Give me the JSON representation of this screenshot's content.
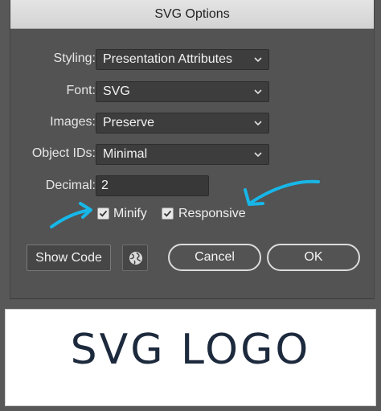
{
  "window": {
    "title": "SVG Options"
  },
  "fields": {
    "styling": {
      "label": "Styling:",
      "value": "Presentation Attributes"
    },
    "font": {
      "label": "Font:",
      "value": "SVG"
    },
    "images": {
      "label": "Images:",
      "value": "Preserve"
    },
    "object_ids": {
      "label": "Object IDs:",
      "value": "Minimal"
    },
    "decimal": {
      "label": "Decimal:",
      "value": "2"
    }
  },
  "checkboxes": {
    "minify": {
      "label": "Minify",
      "checked": true
    },
    "responsive": {
      "label": "Responsive",
      "checked": true
    }
  },
  "buttons": {
    "show_code": "Show Code",
    "cancel": "Cancel",
    "ok": "OK",
    "globe_icon": "globe-icon"
  },
  "preview": {
    "logo_text": "SVG LOGO"
  },
  "colors": {
    "annotation_arrow": "#17b7e8",
    "logo_text": "#1d2a3d",
    "dialog_bg": "#535353"
  }
}
